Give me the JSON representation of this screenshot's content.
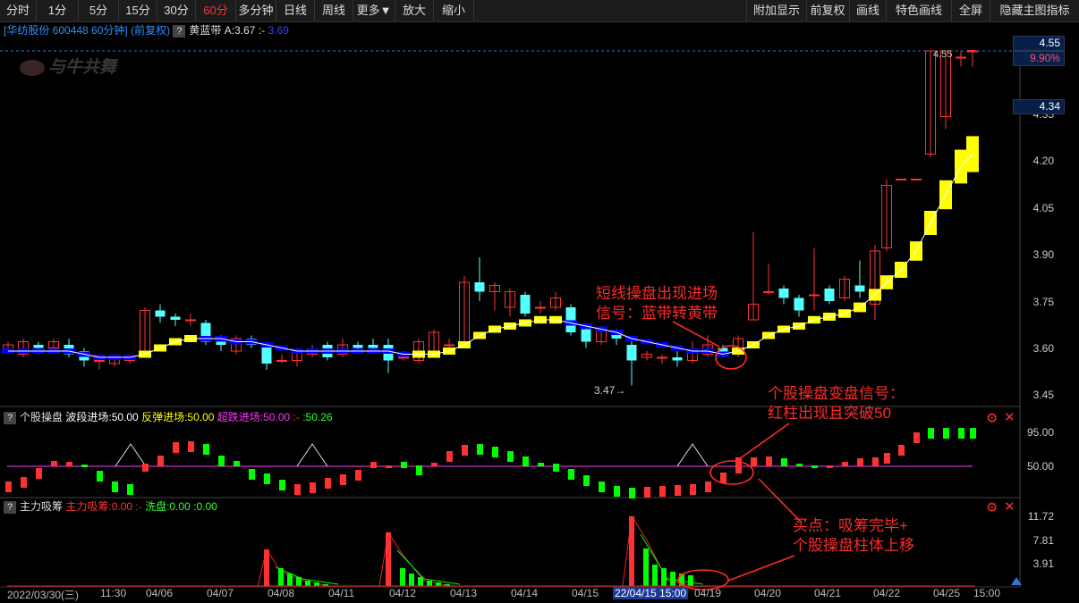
{
  "toolbar": {
    "left": [
      "分时",
      "1分",
      "5分",
      "15分",
      "30分",
      "60分",
      "多分钟",
      "日线",
      "周线",
      "更多▼",
      "放大",
      "缩小"
    ],
    "active": "60分",
    "right": [
      "附加显示",
      "前复权",
      "画线",
      "特色画线",
      "全屏",
      "隐藏主图指标"
    ]
  },
  "main": {
    "stock": "[华纺股份 600448 60分钟]",
    "adjust": "(前复权)",
    "indicator": "黄蓝带",
    "ind_val": "A:3.67",
    "ind_sep": ":-",
    "ind_val2": "3.69",
    "watermark": "与牛共舞",
    "y_ticks": [
      "4.35",
      "4.20",
      "4.05",
      "3.90",
      "3.75",
      "3.60",
      "3.45"
    ],
    "price_box_1": "4.55",
    "price_box_2": "9.90%",
    "price_box_3": "4.34",
    "high_label": "4.55",
    "low_label": "3.47"
  },
  "sub1": {
    "name": "个股操盘",
    "l1": "波段进场:50.00",
    "l2": "反弹进场:50.00",
    "l3": "超跌进场:50.00",
    "l4": ":-",
    "l5": ":50.26",
    "y_ticks": [
      "95.00",
      "50.00"
    ]
  },
  "sub2": {
    "name": "主力吸筹",
    "l1": "主力吸筹:0.00",
    "l2": ":-",
    "l3": "洗盘:0.00",
    "l4": ":0.00",
    "y_ticks": [
      "11.72",
      "7.81",
      "3.91"
    ]
  },
  "dates": [
    "2022/03/30(三)",
    "11:30",
    "04/06",
    "04/07",
    "04/08",
    "04/11",
    "04/12",
    "04/13",
    "04/14",
    "04/15",
    "22/04/15 15:00",
    "04/19",
    "04/20",
    "04/21",
    "04/22",
    "04/25",
    "15:00"
  ],
  "annotations": {
    "a1_l1": "短线操盘出现进场",
    "a1_l2": "信号：蓝带转黄带",
    "a2_l1": "个股操盘变盘信号：",
    "a2_l2": "红柱出现且突破50",
    "a3_l1": "买点：吸筹完毕+",
    "a3_l2": "个股操盘柱体上移"
  },
  "colors": {
    "up": "#ff3232",
    "down": "#54ffff",
    "yellow": "#ffff00",
    "blue": "#0000ff",
    "magenta": "#cc33cc",
    "green": "#00ff00"
  }
}
